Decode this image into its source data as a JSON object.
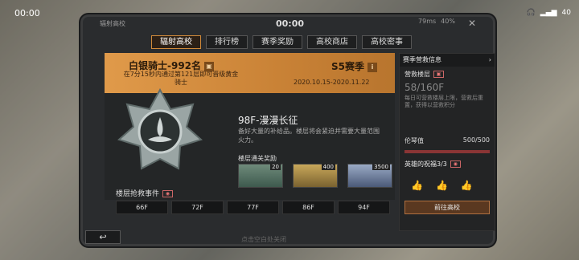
{
  "status": {
    "time": "00:00",
    "battery": "40"
  },
  "panel": {
    "title": "辐射高校",
    "clock": "00:00",
    "signal": "79ms",
    "batt": "40%",
    "close": "✕"
  },
  "tabs": [
    "辐射高校",
    "排行榜",
    "赛季奖励",
    "高校商店",
    "高校密事"
  ],
  "rank": {
    "title": "白银骑士-992名",
    "desc": "在7分15秒内通过第121层即可晋级黄金骑士",
    "season": "S5赛季",
    "dates": "2020.10.15-2020.11.22"
  },
  "floor": {
    "name": "98F-漫漫长征",
    "desc": "备好大量的补给品。楼层将会紧迫并需要大量范围火力。",
    "reward_label": "楼层通关奖励",
    "rewards": [
      {
        "count": "20",
        "color": "g"
      },
      {
        "count": "400",
        "color": "y"
      },
      {
        "count": "3500",
        "color": "b"
      }
    ]
  },
  "rescue": {
    "label": "楼层抢救事件",
    "floors": [
      "66F",
      "72F",
      "77F",
      "86F",
      "94F"
    ]
  },
  "side": {
    "head": "赛季营救信息",
    "sub": "营救楼层",
    "hp": "58/160F",
    "text": "每日可营救楼层上限，营救后重置，获得以营救积分",
    "faith_label": "伦琴值",
    "faith_val": "500/500",
    "bless": "英雄的祝福3/3",
    "goto": "前往高校"
  },
  "back": "↩",
  "hint": "点击空白处关闭"
}
